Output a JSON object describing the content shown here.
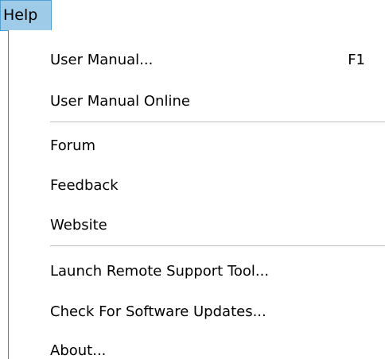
{
  "menubar": {
    "help_label": "Help"
  },
  "menu": {
    "items": [
      {
        "label": "User Manual...",
        "shortcut": "F1"
      },
      {
        "label": "User Manual Online",
        "shortcut": ""
      },
      {
        "label": "Forum",
        "shortcut": ""
      },
      {
        "label": "Feedback",
        "shortcut": ""
      },
      {
        "label": "Website",
        "shortcut": ""
      },
      {
        "label": "Launch Remote Support Tool...",
        "shortcut": ""
      },
      {
        "label": "Check For Software Updates...",
        "shortcut": ""
      },
      {
        "label": "About...",
        "shortcut": ""
      }
    ]
  },
  "colors": {
    "menubar_highlight": "#9ecbe8",
    "menubar_highlight_border": "#4f9fd5",
    "menu_border": "#767676",
    "separator": "#bdbdbd"
  }
}
